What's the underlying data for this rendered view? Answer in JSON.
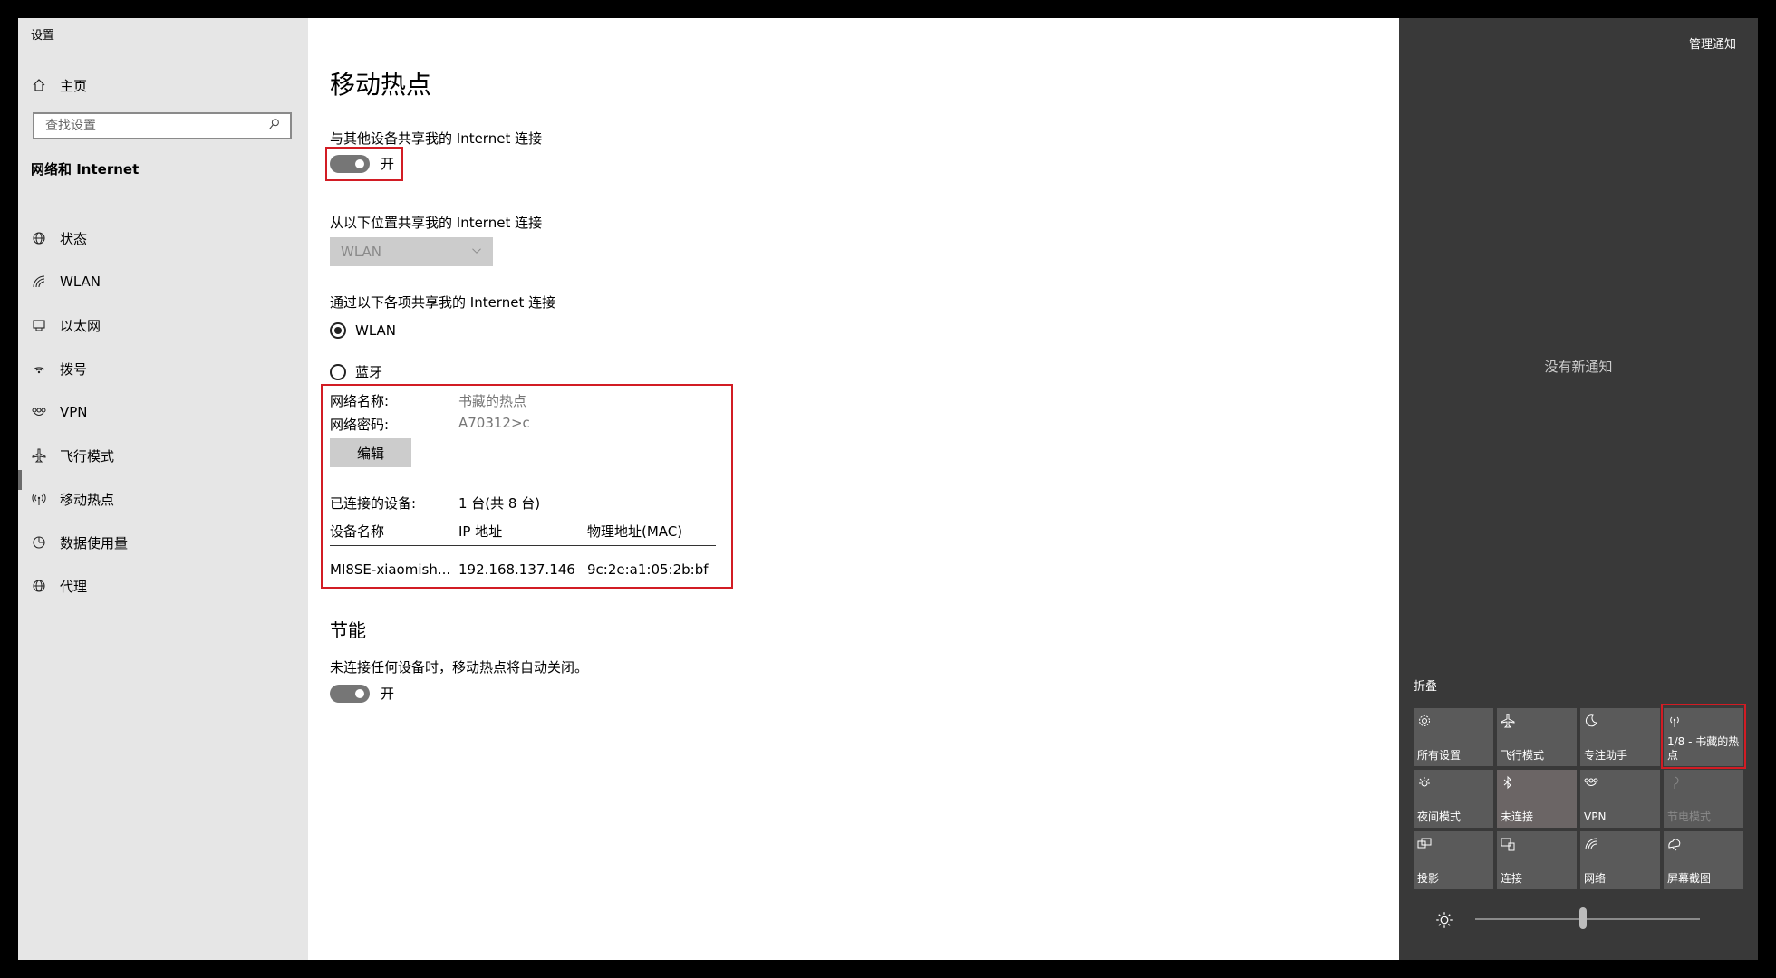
{
  "window": {
    "title": "设置"
  },
  "sidebar": {
    "home": "主页",
    "search_placeholder": "查找设置",
    "section": "网络和 Internet",
    "items": [
      {
        "label": "状态",
        "icon": "globe-status-icon"
      },
      {
        "label": "WLAN",
        "icon": "wifi-icon"
      },
      {
        "label": "以太网",
        "icon": "ethernet-icon"
      },
      {
        "label": "拨号",
        "icon": "dialup-icon"
      },
      {
        "label": "VPN",
        "icon": "vpn-icon"
      },
      {
        "label": "飞行模式",
        "icon": "airplane-icon"
      },
      {
        "label": "移动热点",
        "icon": "hotspot-icon",
        "selected": true
      },
      {
        "label": "数据使用量",
        "icon": "data-usage-icon"
      },
      {
        "label": "代理",
        "icon": "proxy-globe-icon"
      }
    ]
  },
  "main": {
    "title": "移动热点",
    "share_label": "与其他设备共享我的 Internet 连接",
    "share_toggle": "开",
    "share_from_label": "从以下位置共享我的 Internet 连接",
    "share_from_value": "WLAN",
    "share_over_label": "通过以下各项共享我的 Internet 连接",
    "radio_wlan": "WLAN",
    "radio_bt": "蓝牙",
    "net_name_label": "网络名称:",
    "net_name_value": "书藏的热点",
    "net_pwd_label": "网络密码:",
    "net_pwd_value": "A70312>c",
    "edit_button": "编辑",
    "connected_label": "已连接的设备:",
    "connected_value": "1 台(共 8 台)",
    "table_headers": [
      "设备名称",
      "IP 地址",
      "物理地址(MAC)"
    ],
    "table_rows": [
      [
        "MI8SE-xiaomish...",
        "192.168.137.146",
        "9c:2e:a1:05:2b:bf"
      ]
    ],
    "power_title": "节能",
    "power_desc": "未连接任何设备时，移动热点将自动关闭。",
    "power_toggle": "开"
  },
  "action_center": {
    "manage": "管理通知",
    "no_new": "没有新通知",
    "collapse": "折叠",
    "tiles": [
      {
        "label": "所有设置",
        "icon": "gear-icon"
      },
      {
        "label": "飞行模式",
        "icon": "airplane-icon"
      },
      {
        "label": "专注助手",
        "icon": "moon-icon"
      },
      {
        "label": "1/8 - 书藏的热点",
        "icon": "hotspot-icon"
      },
      {
        "label": "夜间模式",
        "icon": "night-light-icon"
      },
      {
        "label": "未连接",
        "icon": "bluetooth-icon"
      },
      {
        "label": "VPN",
        "icon": "vpn-icon"
      },
      {
        "label": "节电模式",
        "icon": "battery-saver-icon"
      },
      {
        "label": "投影",
        "icon": "project-icon"
      },
      {
        "label": "连接",
        "icon": "connect-icon"
      },
      {
        "label": "网络",
        "icon": "network-icon"
      },
      {
        "label": "屏幕截图",
        "icon": "screenshot-icon"
      }
    ],
    "brightness_icon": "brightness-icon",
    "brightness_level": 0.48
  },
  "colors": {
    "highlight_red": "#d21c24",
    "sidebar_bg": "#e6e6e6",
    "action_center_bg": "#393939",
    "tile_bg": "#5a5a5a"
  }
}
